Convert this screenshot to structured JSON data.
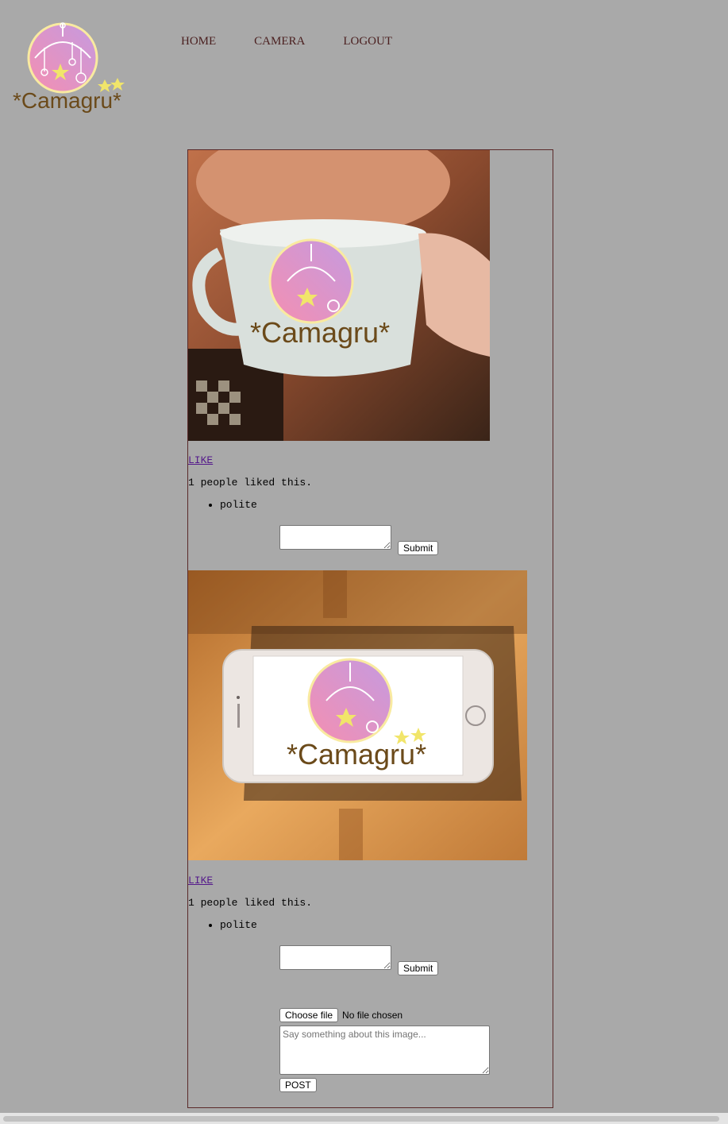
{
  "logo": {
    "wordmark": "*Camagru*"
  },
  "nav": {
    "items": [
      {
        "label": "HOME"
      },
      {
        "label": "CAMERA"
      },
      {
        "label": "LOGOUT"
      }
    ]
  },
  "posts": [
    {
      "like_label": "LIKE",
      "likes_text": "1 people liked this.",
      "comments": [
        "polite"
      ],
      "submit_label": "Submit"
    },
    {
      "like_label": "LIKE",
      "likes_text": "1 people liked this.",
      "comments": [
        "polite"
      ],
      "submit_label": "Submit"
    }
  ],
  "upload": {
    "choose_label": "Choose file",
    "no_file_text": "No file chosen",
    "caption_placeholder": "Say something about this image...",
    "post_label": "POST"
  },
  "colors": {
    "background": "#a9a9a9",
    "nav_text": "#4a1f1f",
    "link": "#551a8b",
    "border": "#5a2a2a"
  }
}
